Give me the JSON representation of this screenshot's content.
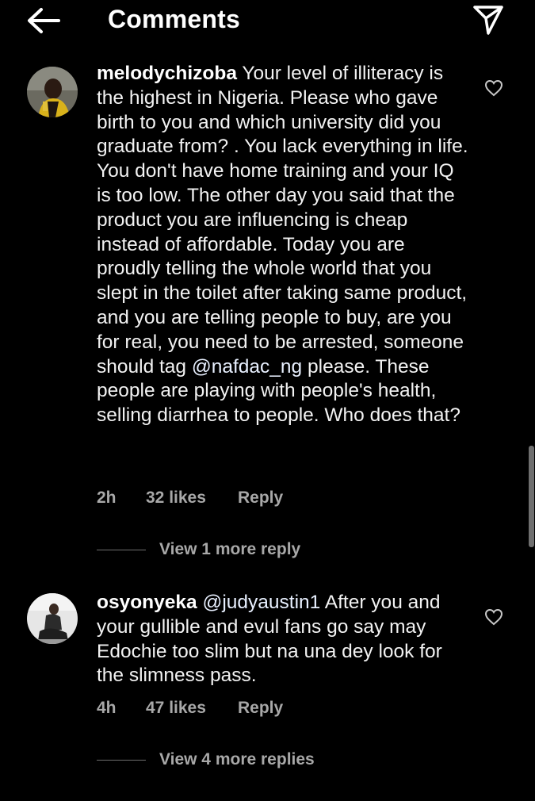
{
  "header": {
    "title": "Comments",
    "back_icon": "arrow-left-icon",
    "share_icon": "paper-plane-icon"
  },
  "comments": [
    {
      "username": "melodychizoba",
      "text": "Your level of illiteracy is the highest in Nigeria. Please who gave birth to you and which university did you graduate from? . You lack everything in life. You don't have home training and your IQ is too low. The other day you said that the product you are influencing is cheap instead of affordable. Today you are proudly telling the whole world that you slept in the toilet after taking same product, and you are telling people to buy, are you for real, you need to be arrested, someone should tag",
      "mention": "@nafdac_ng",
      "text_after": "please. These people are playing with people's health, selling diarrhea to people. Who does that?",
      "time": "2h",
      "likes": "32 likes",
      "reply_label": "Reply",
      "view_replies": "View 1 more reply"
    },
    {
      "username": "osyonyeka",
      "mention": "@judyaustin1",
      "text": "After you and your gullible and evul fans go say may Edochie too slim but na una dey look for the slimness pass.",
      "time": "4h",
      "likes": "47 likes",
      "reply_label": "Reply",
      "view_replies": "View 4 more replies"
    }
  ],
  "colors": {
    "background": "#000000",
    "text": "#ffffff",
    "secondary": "#a8a8a8"
  }
}
